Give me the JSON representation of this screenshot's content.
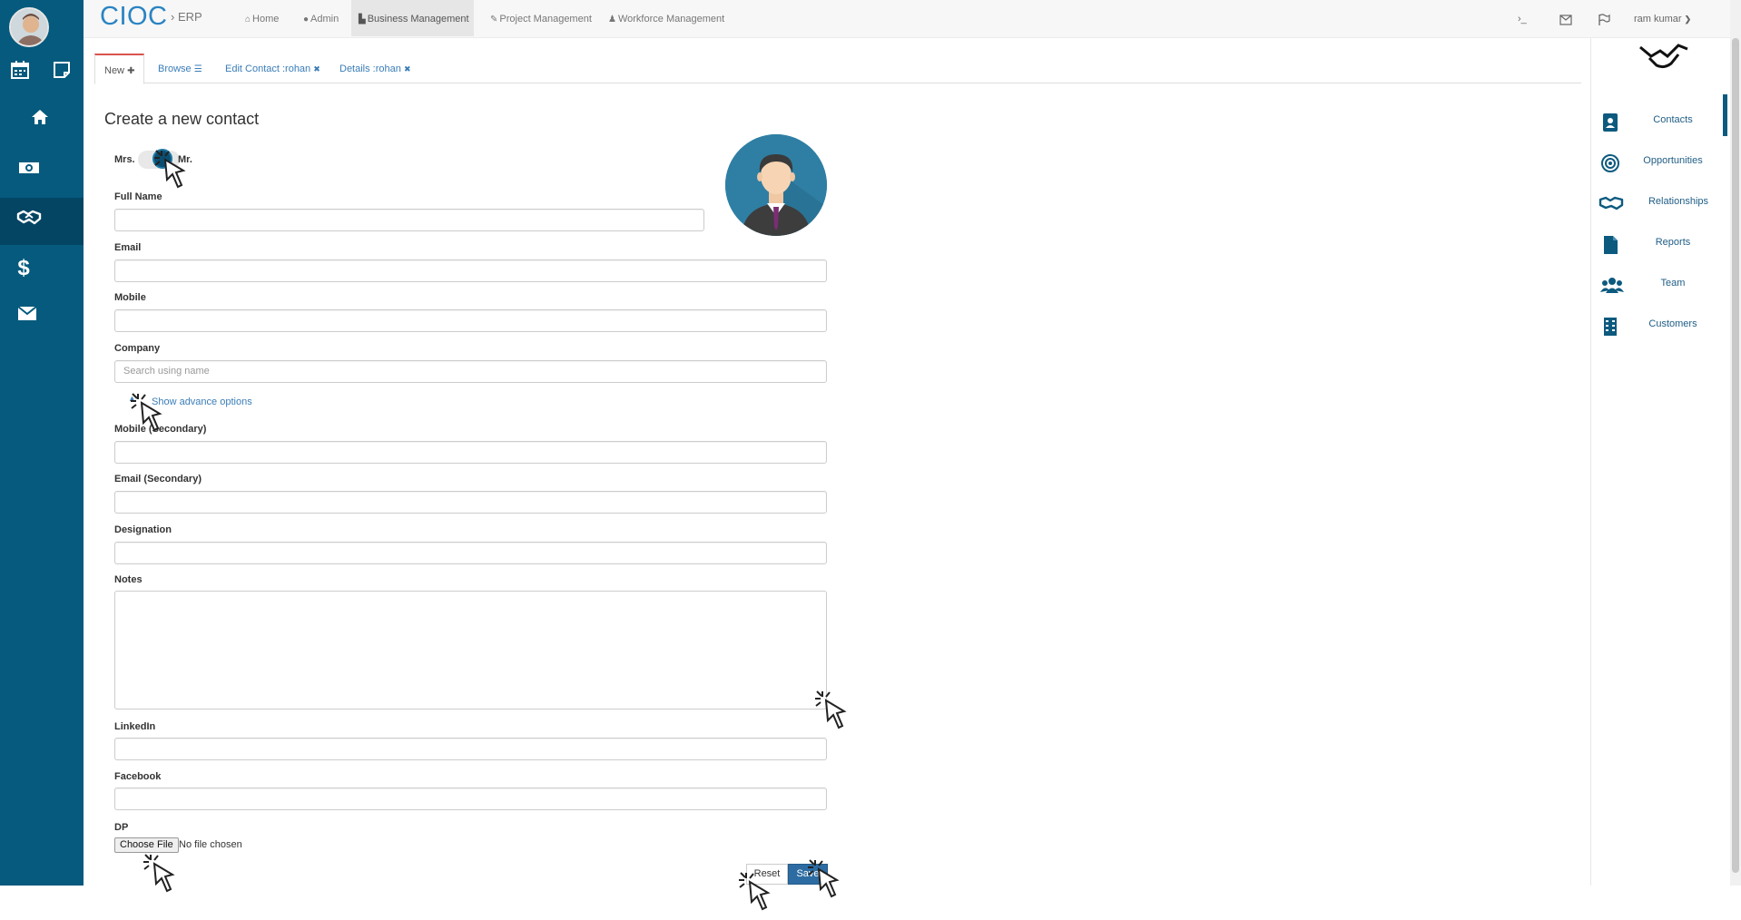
{
  "brand": {
    "name": "CIOC",
    "separator": "›",
    "sub": "ERP"
  },
  "nav": [
    {
      "label": "Home",
      "icon": "home-icon"
    },
    {
      "label": "Admin",
      "icon": "user-icon"
    },
    {
      "label": "Business Management",
      "icon": "industry-icon"
    },
    {
      "label": "Project Management",
      "icon": "wrench-icon"
    },
    {
      "label": "Workforce Management",
      "icon": "users-icon"
    }
  ],
  "top_right": {
    "terminal": "›_",
    "user": "ram kumar"
  },
  "tabs": [
    {
      "label": "New",
      "suffix": "✚"
    },
    {
      "label": "Browse",
      "suffix": "☰"
    },
    {
      "label": "Edit Contact :rohan",
      "suffix": "✖"
    },
    {
      "label": "Details :rohan",
      "suffix": "✖"
    }
  ],
  "form": {
    "title": "Create a new contact",
    "toggle_left": "Mrs.",
    "toggle_right": "Mr.",
    "full_name_label": "Full Name",
    "email_label": "Email",
    "mobile_label": "Mobile",
    "company_label": "Company",
    "company_placeholder": "Search using name",
    "advance_link": "Show advance options",
    "mobile2_label": "Mobile (Secondary)",
    "email2_label": "Email (Secondary)",
    "designation_label": "Designation",
    "notes_label": "Notes",
    "linkedin_label": "LinkedIn",
    "facebook_label": "Facebook",
    "dp_label": "DP",
    "file_button": "Choose File",
    "file_status": "No file chosen",
    "reset_label": "Reset",
    "save_label": "Save"
  },
  "right_panel": [
    {
      "label": "Contacts",
      "icon": "contacts-book-icon"
    },
    {
      "label": "Opportunities",
      "icon": "target-icon"
    },
    {
      "label": "Relationships",
      "icon": "handshake-icon"
    },
    {
      "label": "Reports",
      "icon": "file-icon"
    },
    {
      "label": "Team",
      "icon": "team-icon"
    },
    {
      "label": "Customers",
      "icon": "building-icon"
    }
  ],
  "colors": {
    "sidebar": "#055a7d",
    "brand": "#2a84c2",
    "link": "#3a7db7",
    "save": "#2d6ca2",
    "active_tab_border": "#d9534f"
  }
}
